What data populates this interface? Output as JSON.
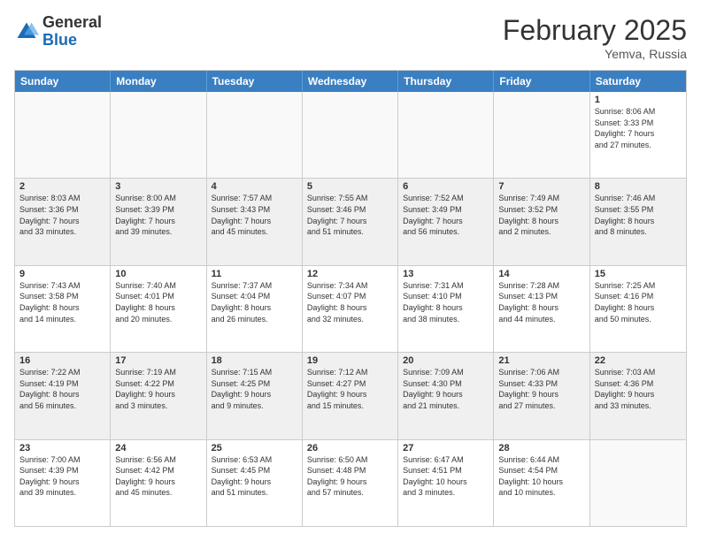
{
  "logo": {
    "general": "General",
    "blue": "Blue"
  },
  "header": {
    "month": "February 2025",
    "location": "Yemva, Russia"
  },
  "weekdays": [
    "Sunday",
    "Monday",
    "Tuesday",
    "Wednesday",
    "Thursday",
    "Friday",
    "Saturday"
  ],
  "rows": [
    [
      {
        "day": "",
        "empty": true
      },
      {
        "day": "",
        "empty": true
      },
      {
        "day": "",
        "empty": true
      },
      {
        "day": "",
        "empty": true
      },
      {
        "day": "",
        "empty": true
      },
      {
        "day": "",
        "empty": true
      },
      {
        "day": "1",
        "info": "Sunrise: 8:06 AM\nSunset: 3:33 PM\nDaylight: 7 hours\nand 27 minutes."
      }
    ],
    [
      {
        "day": "2",
        "info": "Sunrise: 8:03 AM\nSunset: 3:36 PM\nDaylight: 7 hours\nand 33 minutes.",
        "shaded": true
      },
      {
        "day": "3",
        "info": "Sunrise: 8:00 AM\nSunset: 3:39 PM\nDaylight: 7 hours\nand 39 minutes.",
        "shaded": true
      },
      {
        "day": "4",
        "info": "Sunrise: 7:57 AM\nSunset: 3:43 PM\nDaylight: 7 hours\nand 45 minutes.",
        "shaded": true
      },
      {
        "day": "5",
        "info": "Sunrise: 7:55 AM\nSunset: 3:46 PM\nDaylight: 7 hours\nand 51 minutes.",
        "shaded": true
      },
      {
        "day": "6",
        "info": "Sunrise: 7:52 AM\nSunset: 3:49 PM\nDaylight: 7 hours\nand 56 minutes.",
        "shaded": true
      },
      {
        "day": "7",
        "info": "Sunrise: 7:49 AM\nSunset: 3:52 PM\nDaylight: 8 hours\nand 2 minutes.",
        "shaded": true
      },
      {
        "day": "8",
        "info": "Sunrise: 7:46 AM\nSunset: 3:55 PM\nDaylight: 8 hours\nand 8 minutes.",
        "shaded": true
      }
    ],
    [
      {
        "day": "9",
        "info": "Sunrise: 7:43 AM\nSunset: 3:58 PM\nDaylight: 8 hours\nand 14 minutes."
      },
      {
        "day": "10",
        "info": "Sunrise: 7:40 AM\nSunset: 4:01 PM\nDaylight: 8 hours\nand 20 minutes."
      },
      {
        "day": "11",
        "info": "Sunrise: 7:37 AM\nSunset: 4:04 PM\nDaylight: 8 hours\nand 26 minutes."
      },
      {
        "day": "12",
        "info": "Sunrise: 7:34 AM\nSunset: 4:07 PM\nDaylight: 8 hours\nand 32 minutes."
      },
      {
        "day": "13",
        "info": "Sunrise: 7:31 AM\nSunset: 4:10 PM\nDaylight: 8 hours\nand 38 minutes."
      },
      {
        "day": "14",
        "info": "Sunrise: 7:28 AM\nSunset: 4:13 PM\nDaylight: 8 hours\nand 44 minutes."
      },
      {
        "day": "15",
        "info": "Sunrise: 7:25 AM\nSunset: 4:16 PM\nDaylight: 8 hours\nand 50 minutes."
      }
    ],
    [
      {
        "day": "16",
        "info": "Sunrise: 7:22 AM\nSunset: 4:19 PM\nDaylight: 8 hours\nand 56 minutes.",
        "shaded": true
      },
      {
        "day": "17",
        "info": "Sunrise: 7:19 AM\nSunset: 4:22 PM\nDaylight: 9 hours\nand 3 minutes.",
        "shaded": true
      },
      {
        "day": "18",
        "info": "Sunrise: 7:15 AM\nSunset: 4:25 PM\nDaylight: 9 hours\nand 9 minutes.",
        "shaded": true
      },
      {
        "day": "19",
        "info": "Sunrise: 7:12 AM\nSunset: 4:27 PM\nDaylight: 9 hours\nand 15 minutes.",
        "shaded": true
      },
      {
        "day": "20",
        "info": "Sunrise: 7:09 AM\nSunset: 4:30 PM\nDaylight: 9 hours\nand 21 minutes.",
        "shaded": true
      },
      {
        "day": "21",
        "info": "Sunrise: 7:06 AM\nSunset: 4:33 PM\nDaylight: 9 hours\nand 27 minutes.",
        "shaded": true
      },
      {
        "day": "22",
        "info": "Sunrise: 7:03 AM\nSunset: 4:36 PM\nDaylight: 9 hours\nand 33 minutes.",
        "shaded": true
      }
    ],
    [
      {
        "day": "23",
        "info": "Sunrise: 7:00 AM\nSunset: 4:39 PM\nDaylight: 9 hours\nand 39 minutes."
      },
      {
        "day": "24",
        "info": "Sunrise: 6:56 AM\nSunset: 4:42 PM\nDaylight: 9 hours\nand 45 minutes."
      },
      {
        "day": "25",
        "info": "Sunrise: 6:53 AM\nSunset: 4:45 PM\nDaylight: 9 hours\nand 51 minutes."
      },
      {
        "day": "26",
        "info": "Sunrise: 6:50 AM\nSunset: 4:48 PM\nDaylight: 9 hours\nand 57 minutes."
      },
      {
        "day": "27",
        "info": "Sunrise: 6:47 AM\nSunset: 4:51 PM\nDaylight: 10 hours\nand 3 minutes."
      },
      {
        "day": "28",
        "info": "Sunrise: 6:44 AM\nSunset: 4:54 PM\nDaylight: 10 hours\nand 10 minutes."
      },
      {
        "day": "",
        "empty": true
      }
    ]
  ]
}
